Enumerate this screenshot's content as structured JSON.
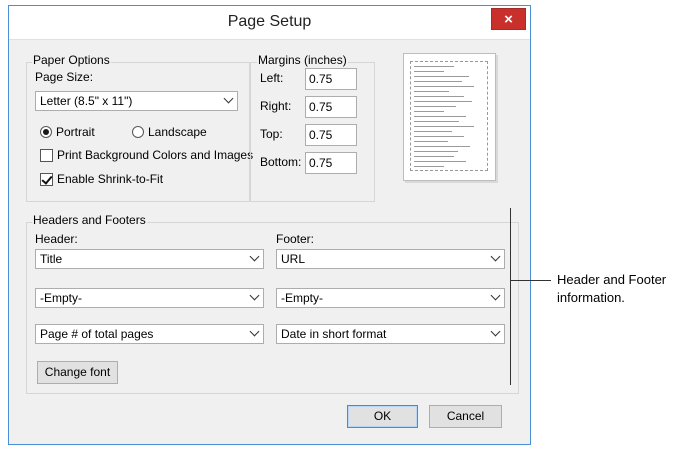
{
  "title": "Page Setup",
  "close_icon": "×",
  "paper_options": {
    "label": "Paper Options",
    "page_size_label": "Page Size:",
    "page_size_value": "Letter (8.5\" x 11\")",
    "portrait_label": "Portrait",
    "landscape_label": "Landscape",
    "orientation_selected": "Portrait",
    "print_bg_label": "Print Background Colors and Images",
    "print_bg_checked": false,
    "shrink_label": "Enable Shrink-to-Fit",
    "shrink_checked": true
  },
  "margins": {
    "label": "Margins (inches)",
    "left_label": "Left:",
    "left_value": "0.75",
    "right_label": "Right:",
    "right_value": "0.75",
    "top_label": "Top:",
    "top_value": "0.75",
    "bottom_label": "Bottom:",
    "bottom_value": "0.75"
  },
  "headers_footers": {
    "label": "Headers and Footers",
    "header_label": "Header:",
    "footer_label": "Footer:",
    "header_values": [
      "Title",
      "-Empty-",
      "Page # of total pages"
    ],
    "footer_values": [
      "URL",
      "-Empty-",
      "Date in short format"
    ],
    "change_font_label": "Change font"
  },
  "buttons": {
    "ok_label": "OK",
    "cancel_label": "Cancel"
  },
  "callout": {
    "text": "Header and Footer information."
  }
}
